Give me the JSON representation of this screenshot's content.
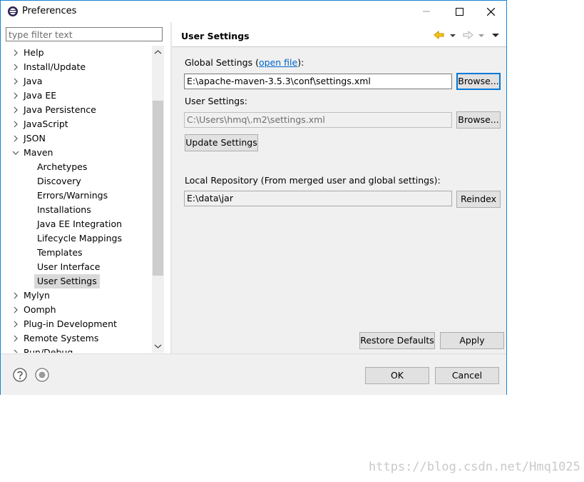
{
  "window": {
    "title": "Preferences"
  },
  "filter": {
    "placeholder": "type filter text"
  },
  "tree": {
    "top_items": [
      {
        "label": "Help"
      },
      {
        "label": "Install/Update"
      },
      {
        "label": "Java"
      },
      {
        "label": "Java EE"
      },
      {
        "label": "Java Persistence"
      },
      {
        "label": "JavaScript"
      },
      {
        "label": "JSON"
      },
      {
        "label": "Maven",
        "expanded": true
      }
    ],
    "maven_children": [
      {
        "label": "Archetypes"
      },
      {
        "label": "Discovery"
      },
      {
        "label": "Errors/Warnings"
      },
      {
        "label": "Installations"
      },
      {
        "label": "Java EE Integration"
      },
      {
        "label": "Lifecycle Mappings"
      },
      {
        "label": "Templates"
      },
      {
        "label": "User Interface"
      },
      {
        "label": "User Settings",
        "selected": true
      }
    ],
    "bottom_items": [
      {
        "label": "Mylyn"
      },
      {
        "label": "Oomph"
      },
      {
        "label": "Plug-in Development"
      },
      {
        "label": "Remote Systems"
      },
      {
        "label": "Run/Debug"
      }
    ]
  },
  "page": {
    "title": "User Settings",
    "global_label_prefix": "Global Settings (",
    "global_link": "open file",
    "global_label_suffix": "):",
    "global_value": "E:\\apache-maven-3.5.3\\conf\\settings.xml",
    "user_label": "User Settings:",
    "user_placeholder": "C:\\Users\\hmq\\.m2\\settings.xml",
    "browse_label": "Browse...",
    "update_label": "Update Settings",
    "local_repo_label": "Local Repository (From merged user and global settings):",
    "local_repo_value": "E:\\data\\jar",
    "reindex_label": "Reindex",
    "restore_label": "Restore Defaults",
    "apply_label": "Apply"
  },
  "footer": {
    "ok_label": "OK",
    "cancel_label": "Cancel"
  },
  "watermark": "https://blog.csdn.net/Hmq1025",
  "colors": {
    "accent": "#0078d7",
    "link": "#0066cc",
    "nav_arrow": "#d8a400"
  }
}
